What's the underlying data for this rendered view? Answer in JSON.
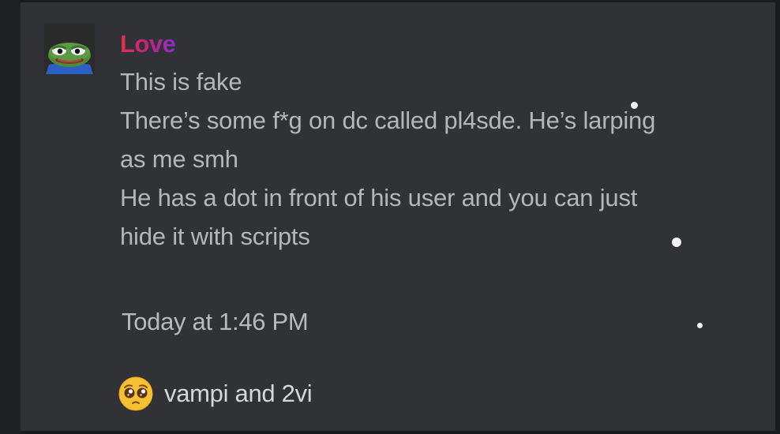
{
  "message": {
    "author": "Love",
    "author_gradient": [
      "#e0334d",
      "#c2247e",
      "#8b2fc9"
    ],
    "avatar_icon": "pepe-frog-avatar-icon",
    "lines": [
      "This is fake",
      "There’s some f*g on dc called pl4sde. He’s larping",
      "as me smh",
      "He has a dot in front of his user and you can just",
      "hide it with scripts"
    ],
    "timestamp": "Today at 1:46 PM"
  },
  "reaction": {
    "emoji_icon": "pleading-face-emoji-icon",
    "text": "vampi and 2vi"
  },
  "colors": {
    "card_background": "#313236",
    "text": "#b4b6ba"
  }
}
